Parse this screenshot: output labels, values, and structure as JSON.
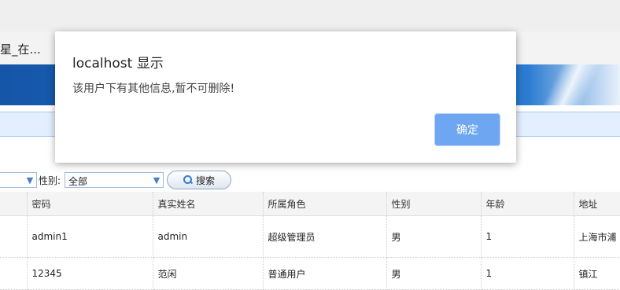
{
  "window": {
    "tab_title": "星_在..."
  },
  "filter": {
    "gender_label": "性别:",
    "gender_value": "全部",
    "search_label": "搜索"
  },
  "table": {
    "columns": [
      "密码",
      "真实姓名",
      "所属角色",
      "性别",
      "年龄",
      "地址"
    ],
    "rows": [
      [
        "admin1",
        "admin",
        "超级管理员",
        "男",
        "1",
        "上海市浦"
      ],
      [
        "12345",
        "范闲",
        "普通用户",
        "男",
        "1",
        "镇江"
      ]
    ]
  },
  "dialog": {
    "title": "localhost 显示",
    "message": "该用户下有其他信息,暂不可删除!",
    "ok_label": "确定"
  },
  "colors": {
    "header_blue": "#1a66c0",
    "ok_button": "#6ea6f2"
  },
  "icons": {
    "search": "search-icon",
    "dropdown": "chevron-down-icon"
  }
}
